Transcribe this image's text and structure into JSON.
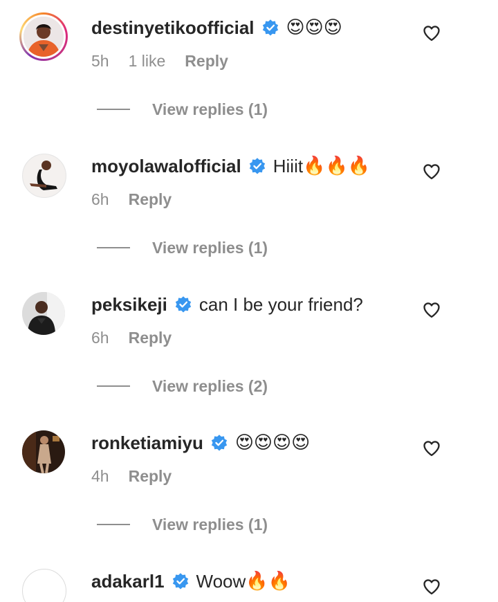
{
  "comments": [
    {
      "username": "destinyetikoofficial",
      "text": "",
      "emoji": "😍😍😍",
      "time": "5h",
      "likes": "1 like",
      "reply_label": "Reply",
      "view_replies": "View replies (1)"
    },
    {
      "username": "moyolawalofficial",
      "text": "Hiiit",
      "emoji": "🔥🔥🔥",
      "time": "6h",
      "likes": "",
      "reply_label": "Reply",
      "view_replies": "View replies (1)"
    },
    {
      "username": "peksikeji",
      "text": "can I be your friend?",
      "emoji": "",
      "time": "6h",
      "likes": "",
      "reply_label": "Reply",
      "view_replies": "View replies (2)"
    },
    {
      "username": "ronketiamiyu",
      "text": "",
      "emoji": "😍😍😍😍",
      "time": "4h",
      "likes": "",
      "reply_label": "Reply",
      "view_replies": "View replies (1)"
    },
    {
      "username": "adakarl1",
      "text": "Woow",
      "emoji": "🔥🔥",
      "time": "",
      "likes": "",
      "reply_label": "",
      "view_replies": ""
    }
  ],
  "colors": {
    "verified_blue": "#3897f0",
    "secondary_text": "#8e8e8e",
    "primary_text": "#262626"
  },
  "icons": {
    "verified": "verified-badge-icon",
    "like": "heart-outline-icon"
  }
}
